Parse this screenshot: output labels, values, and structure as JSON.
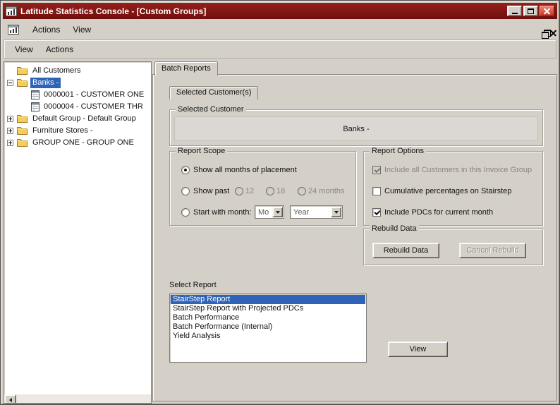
{
  "window": {
    "title": "Latitude Statistics Console - [Custom Groups]"
  },
  "mdi_menu": {
    "items": [
      "Actions",
      "View"
    ]
  },
  "menu_bar": {
    "items": [
      "View",
      "Actions"
    ]
  },
  "tree": {
    "items": [
      {
        "label": "All Customers",
        "type": "folder",
        "expander": "none",
        "selected": false
      },
      {
        "label": "Banks -",
        "type": "folder",
        "expander": "minus",
        "selected": true
      },
      {
        "label": "0000001 - CUSTOMER ONE",
        "type": "report",
        "expander": "none",
        "selected": false
      },
      {
        "label": "0000004 - CUSTOMER THR",
        "type": "report",
        "expander": "none",
        "selected": false
      },
      {
        "label": "Default Group - Default Group",
        "type": "folder",
        "expander": "plus",
        "selected": false
      },
      {
        "label": "Furniture Stores -",
        "type": "folder",
        "expander": "plus",
        "selected": false
      },
      {
        "label": "GROUP ONE - GROUP ONE",
        "type": "folder",
        "expander": "plus",
        "selected": false
      }
    ]
  },
  "tabs": {
    "batch_reports": "Batch Reports",
    "selected_customers": "Selected Customer(s)"
  },
  "selected_customer_group": {
    "label": "Selected Customer",
    "value": "Banks -"
  },
  "report_scope": {
    "label": "Report Scope",
    "show_all": "Show all months of placement",
    "show_past": "Show past",
    "past_options": [
      "12",
      "18",
      "24 months"
    ],
    "start_with": "Start with month:",
    "month_combo": "Mo",
    "year_combo": "Year"
  },
  "report_options": {
    "label": "Report Options",
    "items": [
      {
        "label": "Include all Customers in this Invoice Group",
        "checked": true,
        "disabled": true
      },
      {
        "label": "Cumulative percentages on Stairstep",
        "checked": false,
        "disabled": false
      },
      {
        "label": "Include PDCs for current month",
        "checked": true,
        "disabled": false
      }
    ]
  },
  "rebuild": {
    "label": "Rebuild Data",
    "rebuild_button": "Rebuild Data",
    "cancel_button": "Cancel Rebuild"
  },
  "select_report": {
    "label": "Select Report",
    "selected_index": 0,
    "items": [
      "StairStep Report",
      "StairStep Report with Projected PDCs",
      "Batch Performance",
      "Batch Performance (Internal)",
      "Yield Analysis"
    ]
  },
  "buttons": {
    "view": "View"
  },
  "colors": {
    "titlebar": "#7c1311",
    "selection": "#2e63b8",
    "chrome": "#d4d0c8"
  }
}
